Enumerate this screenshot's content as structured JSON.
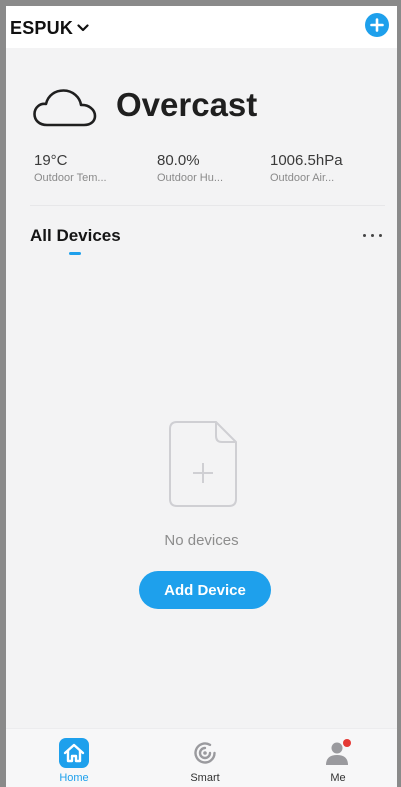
{
  "header": {
    "home_name": "ESPUK"
  },
  "weather": {
    "condition": "Overcast",
    "stats": [
      {
        "value": "19°C",
        "label": "Outdoor Tem..."
      },
      {
        "value": "80.0%",
        "label": "Outdoor Hu..."
      },
      {
        "value": "1006.5hPa",
        "label": "Outdoor Air..."
      }
    ]
  },
  "devices": {
    "tab_label": "All Devices",
    "empty_text": "No devices",
    "add_button_label": "Add Device"
  },
  "tabbar": {
    "items": [
      {
        "label": "Home",
        "icon": "home-icon",
        "active": true
      },
      {
        "label": "Smart",
        "icon": "smart-icon",
        "active": false
      },
      {
        "label": "Me",
        "icon": "user-icon",
        "active": false
      }
    ]
  },
  "colors": {
    "accent": "#1ea0ec",
    "notification_dot": "#e53935",
    "background": "#f3f3f4"
  }
}
